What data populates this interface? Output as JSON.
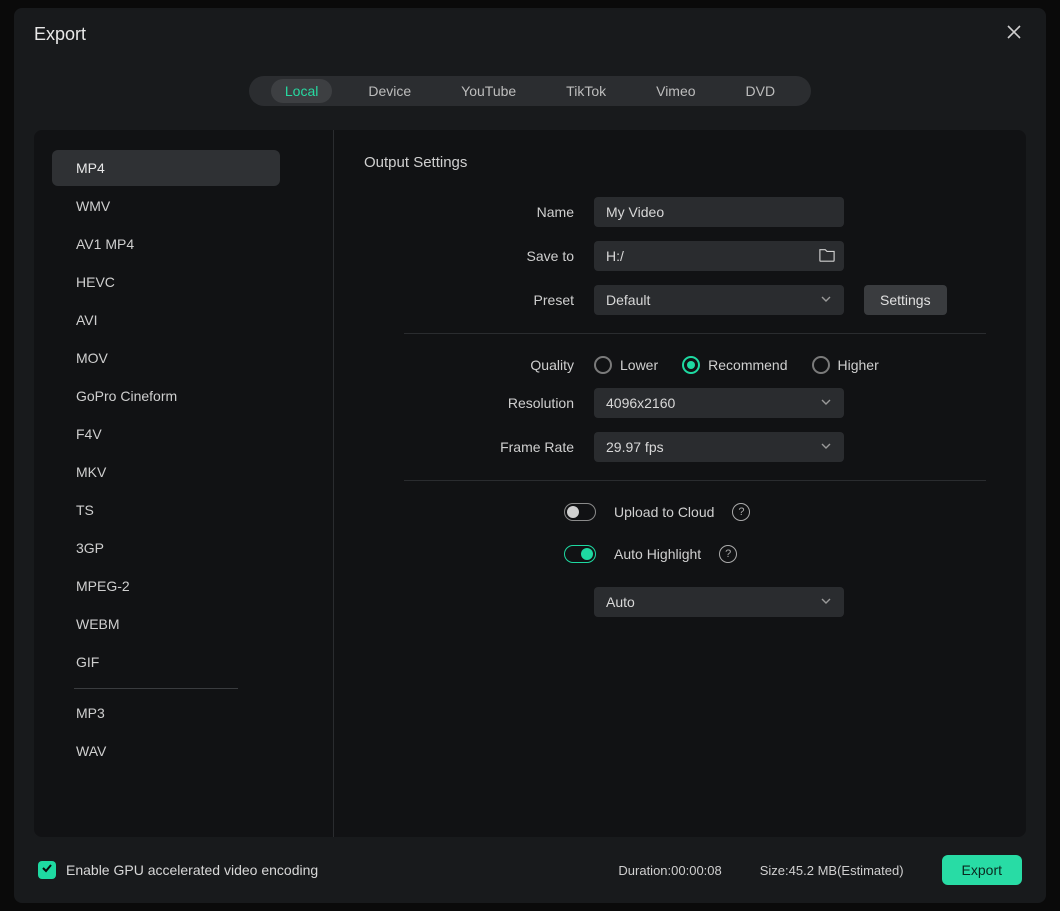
{
  "title": "Export",
  "tabs": [
    "Local",
    "Device",
    "YouTube",
    "TikTok",
    "Vimeo",
    "DVD"
  ],
  "active_tab": 0,
  "formats": [
    "MP4",
    "WMV",
    "AV1 MP4",
    "HEVC",
    "AVI",
    "MOV",
    "GoPro Cineform",
    "F4V",
    "MKV",
    "TS",
    "3GP",
    "MPEG-2",
    "WEBM",
    "GIF"
  ],
  "formats_audio": [
    "MP3",
    "WAV"
  ],
  "active_format": 0,
  "section_title": "Output Settings",
  "labels": {
    "name": "Name",
    "save_to": "Save to",
    "preset": "Preset",
    "quality": "Quality",
    "resolution": "Resolution",
    "frame_rate": "Frame Rate",
    "upload_cloud": "Upload to Cloud",
    "auto_highlight": "Auto Highlight",
    "settings_btn": "Settings"
  },
  "values": {
    "name": "My Video",
    "save_to": "H:/",
    "preset": "Default",
    "resolution": "4096x2160",
    "frame_rate": "29.97 fps",
    "highlight_mode": "Auto"
  },
  "quality_options": [
    "Lower",
    "Recommend",
    "Higher"
  ],
  "quality_selected": 1,
  "toggles": {
    "upload_cloud": false,
    "auto_highlight": true
  },
  "footer": {
    "gpu_label": "Enable GPU accelerated video encoding",
    "gpu_checked": true,
    "duration_label": "Duration:",
    "duration_value": "00:00:08",
    "size_label": "Size:",
    "size_value": "45.2 MB(Estimated)",
    "export_btn": "Export"
  }
}
